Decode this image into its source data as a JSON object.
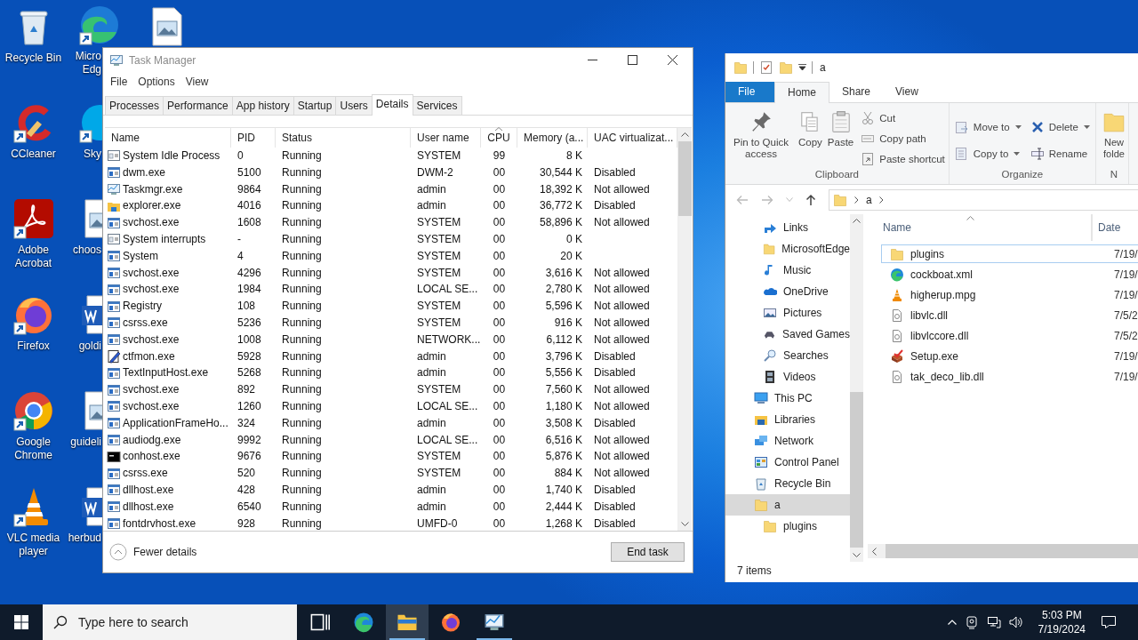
{
  "desktop": {
    "icon_columns": [
      [
        {
          "label": "Recycle Bin",
          "kind": "recycle",
          "shortcut": false
        },
        {
          "label": "CCleaner",
          "kind": "ccleaner",
          "shortcut": true
        },
        {
          "label": "Adobe Acrobat",
          "kind": "acrobat",
          "shortcut": true
        },
        {
          "label": "Firefox",
          "kind": "firefox",
          "shortcut": true
        },
        {
          "label": "Google Chrome",
          "kind": "chrome",
          "shortcut": true
        },
        {
          "label": "VLC media player",
          "kind": "vlc",
          "shortcut": true
        }
      ],
      [
        {
          "label": "Micro Edg",
          "kind": "edge",
          "shortcut": true
        },
        {
          "label": "Sky",
          "kind": "skype",
          "shortcut": true
        },
        {
          "label": "choos",
          "kind": "image",
          "shortcut": false
        },
        {
          "label": "goldi",
          "kind": "word",
          "shortcut": false
        },
        {
          "label": "guideli",
          "kind": "image",
          "shortcut": false
        },
        {
          "label": "herbud",
          "kind": "word",
          "shortcut": false
        }
      ],
      [
        {
          "kind": "image",
          "shortcut": false
        }
      ]
    ]
  },
  "task_manager": {
    "title": "Task Manager",
    "menu": [
      "File",
      "Options",
      "View"
    ],
    "tabs": [
      {
        "label": "Processes",
        "selected": false
      },
      {
        "label": "Performance",
        "selected": false
      },
      {
        "label": "App history",
        "selected": false
      },
      {
        "label": "Startup",
        "selected": false
      },
      {
        "label": "Users",
        "selected": false
      },
      {
        "label": "Details",
        "selected": true
      },
      {
        "label": "Services",
        "selected": false
      }
    ],
    "columns": [
      {
        "label": "Name",
        "sorted": false
      },
      {
        "label": "PID",
        "sorted": false
      },
      {
        "label": "Status",
        "sorted": false
      },
      {
        "label": "User name",
        "sorted": false
      },
      {
        "label": "CPU",
        "sorted": true
      },
      {
        "label": "Memory (a...",
        "sorted": false
      },
      {
        "label": "UAC virtualizat...",
        "sorted": false
      }
    ],
    "rows": [
      {
        "name": "System Idle Process",
        "kind": "system",
        "pid": "0",
        "status": "Running",
        "user": "SYSTEM",
        "cpu": "99",
        "memory": "8 K"
      },
      {
        "name": "dwm.exe",
        "kind": "service",
        "pid": "5100",
        "status": "Running",
        "user": "DWM-2",
        "cpu": "00",
        "memory": "30,544 K",
        "uac": "Disabled"
      },
      {
        "name": "Taskmgr.exe",
        "kind": "taskmgr",
        "pid": "9864",
        "status": "Running",
        "user": "admin",
        "cpu": "00",
        "memory": "18,392 K",
        "uac": "Not allowed"
      },
      {
        "name": "explorer.exe",
        "kind": "explorer",
        "pid": "4016",
        "status": "Running",
        "user": "admin",
        "cpu": "00",
        "memory": "36,772 K",
        "uac": "Disabled"
      },
      {
        "name": "svchost.exe",
        "kind": "service",
        "pid": "1608",
        "status": "Running",
        "user": "SYSTEM",
        "cpu": "00",
        "memory": "58,896 K",
        "uac": "Not allowed"
      },
      {
        "name": "System interrupts",
        "kind": "system",
        "pid": "-",
        "status": "Running",
        "user": "SYSTEM",
        "cpu": "00",
        "memory": "0 K"
      },
      {
        "name": "System",
        "kind": "service",
        "pid": "4",
        "status": "Running",
        "user": "SYSTEM",
        "cpu": "00",
        "memory": "20 K"
      },
      {
        "name": "svchost.exe",
        "kind": "service",
        "pid": "4296",
        "status": "Running",
        "user": "SYSTEM",
        "cpu": "00",
        "memory": "3,616 K",
        "uac": "Not allowed"
      },
      {
        "name": "svchost.exe",
        "kind": "service",
        "pid": "1984",
        "status": "Running",
        "user": "LOCAL SE...",
        "cpu": "00",
        "memory": "2,780 K",
        "uac": "Not allowed"
      },
      {
        "name": "Registry",
        "kind": "service",
        "pid": "108",
        "status": "Running",
        "user": "SYSTEM",
        "cpu": "00",
        "memory": "5,596 K",
        "uac": "Not allowed"
      },
      {
        "name": "csrss.exe",
        "kind": "service",
        "pid": "5236",
        "status": "Running",
        "user": "SYSTEM",
        "cpu": "00",
        "memory": "916 K",
        "uac": "Not allowed"
      },
      {
        "name": "svchost.exe",
        "kind": "service",
        "pid": "1008",
        "status": "Running",
        "user": "NETWORK...",
        "cpu": "00",
        "memory": "6,112 K",
        "uac": "Not allowed"
      },
      {
        "name": "ctfmon.exe",
        "kind": "ctfmon",
        "pid": "5928",
        "status": "Running",
        "user": "admin",
        "cpu": "00",
        "memory": "3,796 K",
        "uac": "Disabled"
      },
      {
        "name": "TextInputHost.exe",
        "kind": "service",
        "pid": "5268",
        "status": "Running",
        "user": "admin",
        "cpu": "00",
        "memory": "5,556 K",
        "uac": "Disabled"
      },
      {
        "name": "svchost.exe",
        "kind": "service",
        "pid": "892",
        "status": "Running",
        "user": "SYSTEM",
        "cpu": "00",
        "memory": "7,560 K",
        "uac": "Not allowed"
      },
      {
        "name": "svchost.exe",
        "kind": "service",
        "pid": "1260",
        "status": "Running",
        "user": "LOCAL SE...",
        "cpu": "00",
        "memory": "1,180 K",
        "uac": "Not allowed"
      },
      {
        "name": "ApplicationFrameHo...",
        "kind": "service",
        "pid": "324",
        "status": "Running",
        "user": "admin",
        "cpu": "00",
        "memory": "3,508 K",
        "uac": "Disabled"
      },
      {
        "name": "audiodg.exe",
        "kind": "service",
        "pid": "9992",
        "status": "Running",
        "user": "LOCAL SE...",
        "cpu": "00",
        "memory": "6,516 K",
        "uac": "Not allowed"
      },
      {
        "name": "conhost.exe",
        "kind": "console",
        "pid": "9676",
        "status": "Running",
        "user": "SYSTEM",
        "cpu": "00",
        "memory": "5,876 K",
        "uac": "Not allowed"
      },
      {
        "name": "csrss.exe",
        "kind": "service",
        "pid": "520",
        "status": "Running",
        "user": "SYSTEM",
        "cpu": "00",
        "memory": "884 K",
        "uac": "Not allowed"
      },
      {
        "name": "dllhost.exe",
        "kind": "service",
        "pid": "428",
        "status": "Running",
        "user": "admin",
        "cpu": "00",
        "memory": "1,740 K",
        "uac": "Disabled"
      },
      {
        "name": "dllhost.exe",
        "kind": "service",
        "pid": "6540",
        "status": "Running",
        "user": "admin",
        "cpu": "00",
        "memory": "2,444 K",
        "uac": "Disabled"
      },
      {
        "name": "fontdrvhost.exe",
        "kind": "service",
        "pid": "928",
        "status": "Running",
        "user": "UMFD-0",
        "cpu": "00",
        "memory": "1,268 K",
        "uac": "Disabled"
      }
    ],
    "footer": {
      "toggle": "Fewer details",
      "button": "End task"
    }
  },
  "explorer": {
    "title": "a",
    "ribbon_tabs": [
      {
        "label": "File",
        "kind": "file",
        "selected": false
      },
      {
        "label": "Home",
        "kind": "tab",
        "selected": true
      },
      {
        "label": "Share",
        "kind": "tab",
        "selected": false
      },
      {
        "label": "View",
        "kind": "tab",
        "selected": false
      }
    ],
    "groups": [
      {
        "label": "Clipboard",
        "items": [
          {
            "label": "Pin to Quick access",
            "kind": "pin"
          },
          {
            "label": "Copy",
            "kind": "copy"
          },
          {
            "label": "Paste",
            "kind": "paste"
          },
          {
            "buttons": [
              {
                "label": "Cut",
                "kind": "cut",
                "dropdown": false
              },
              {
                "label": "Copy path",
                "kind": "copypath",
                "dropdown": false
              },
              {
                "label": "Paste shortcut",
                "kind": "pasteshortcut",
                "dropdown": false
              }
            ]
          }
        ]
      },
      {
        "label": "Organize",
        "items": [
          {
            "buttons": [
              {
                "label": "Move to",
                "kind": "moveto",
                "dropdown": true
              },
              {
                "label": "Copy to",
                "kind": "copyto",
                "dropdown": true
              }
            ]
          },
          {
            "buttons": [
              {
                "label": "Delete",
                "kind": "delete",
                "dropdown": true
              },
              {
                "label": "Rename",
                "kind": "rename",
                "dropdown": false
              }
            ]
          }
        ]
      },
      {
        "label": "N",
        "items": [
          {
            "label": "New folde",
            "kind": "newfolder"
          }
        ]
      }
    ],
    "address": [
      "a"
    ],
    "nav": [
      {
        "children": [
          {
            "label": "Links",
            "kind": "links",
            "selected": false
          },
          {
            "label": "MicrosoftEdge",
            "kind": "folder",
            "selected": false
          },
          {
            "label": "Music",
            "kind": "music",
            "selected": false
          },
          {
            "label": "OneDrive",
            "kind": "onedrive",
            "selected": false
          },
          {
            "label": "Pictures",
            "kind": "pictures",
            "selected": false
          },
          {
            "label": "Saved Games",
            "kind": "games",
            "selected": false
          },
          {
            "label": "Searches",
            "kind": "search",
            "selected": false
          },
          {
            "label": "Videos",
            "kind": "videos",
            "selected": false
          }
        ]
      },
      {
        "label": "This PC",
        "kind": "thispc",
        "selected": false
      },
      {
        "label": "Libraries",
        "kind": "libraries",
        "selected": false
      },
      {
        "label": "Network",
        "kind": "network",
        "selected": false
      },
      {
        "label": "Control Panel",
        "kind": "control",
        "selected": false
      },
      {
        "label": "Recycle Bin",
        "kind": "recycle",
        "selected": false
      },
      {
        "label": "a",
        "kind": "folder",
        "selected": true,
        "children": [
          {
            "label": "plugins",
            "kind": "folder",
            "selected": false
          }
        ]
      }
    ],
    "columns": [
      {
        "label": "Name",
        "sorted": true
      },
      {
        "label": "Date",
        "sorted": false
      }
    ],
    "files": [
      {
        "name": "plugins",
        "kind": "folder",
        "date": "7/19/",
        "focused": true
      },
      {
        "name": "cockboat.xml",
        "kind": "edge",
        "date": "7/19/",
        "focused": false
      },
      {
        "name": "higherup.mpg",
        "kind": "vlc",
        "date": "7/19/",
        "focused": false
      },
      {
        "name": "libvlc.dll",
        "kind": "dll",
        "date": "7/5/2",
        "focused": false
      },
      {
        "name": "libvlccore.dll",
        "kind": "dll",
        "date": "7/5/2",
        "focused": false
      },
      {
        "name": "Setup.exe",
        "kind": "setup",
        "date": "7/19/",
        "focused": false
      },
      {
        "name": "tak_deco_lib.dll",
        "kind": "dll",
        "date": "7/19/",
        "focused": false
      }
    ],
    "status": "7 items"
  },
  "taskbar": {
    "search_placeholder": "Type here to search",
    "apps": [
      {
        "kind": "taskview",
        "active": false,
        "running": false
      },
      {
        "kind": "edge",
        "active": false,
        "running": false
      },
      {
        "kind": "explorer",
        "active": true,
        "running": true
      },
      {
        "kind": "firefox",
        "active": false,
        "running": false
      },
      {
        "kind": "taskmgr",
        "active": false,
        "running": true
      }
    ],
    "time": "5:03 PM",
    "date": "7/19/2024"
  }
}
